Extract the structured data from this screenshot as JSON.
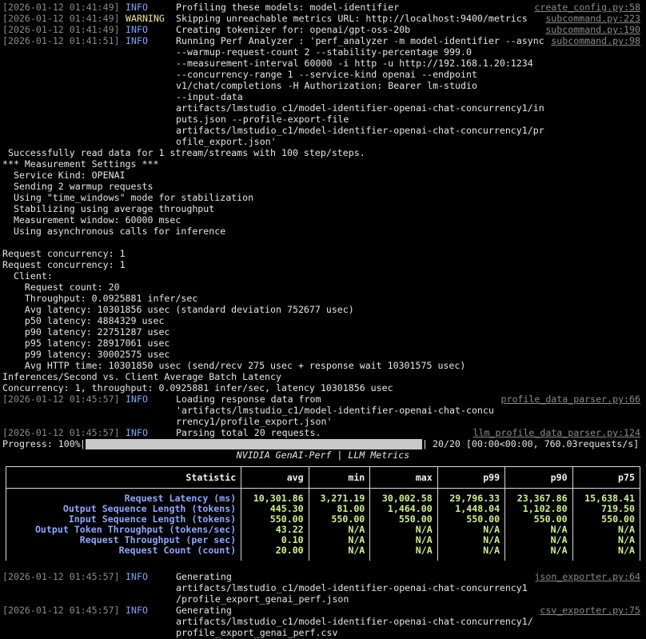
{
  "log_top": [
    {
      "ts": "[2026-01-12 01:41:49]",
      "level": "INFO",
      "msg": "Profiling these models: model-identifier",
      "src": "create_config.py:58"
    },
    {
      "ts": "[2026-01-12 01:41:49]",
      "level": "WARNING",
      "msg": "Skipping unreachable metrics URL: http://localhost:9400/metrics",
      "src": "subcommand.py:223"
    },
    {
      "ts": "[2026-01-12 01:41:49]",
      "level": "INFO",
      "msg": "Creating tokenizer for: openai/gpt-oss-20b",
      "src": "subcommand.py:190"
    },
    {
      "ts": "[2026-01-12 01:41:51]",
      "level": "INFO",
      "msg": "Running Perf Analyzer : 'perf_analyzer -m model-identifier --async",
      "src": "subcommand.py:98"
    }
  ],
  "perf_cmd_cont": [
    "--warmup-request-count 2 --stability-percentage 999.0",
    "--measurement-interval 60000 -i http -u http://192.168.1.20:1234",
    "--concurrency-range 1 --service-kind openai --endpoint",
    "v1/chat/completions -H Authorization: Bearer lm-studio",
    "--input-data",
    "artifacts/lmstudio_c1/model-identifier-openai-chat-concurrency1/in",
    "puts.json --profile-export-file",
    "artifacts/lmstudio_c1/model-identifier-openai-chat-concurrency1/pr",
    "ofile_export.json'"
  ],
  "pa_output": [
    " Successfully read data for 1 stream/streams with 100 step/steps.",
    "*** Measurement Settings ***",
    "  Service Kind: OPENAI",
    "  Sending 2 warmup requests",
    "  Using \"time_windows\" mode for stabilization",
    "  Stabilizing using average throughput",
    "  Measurement window: 60000 msec",
    "  Using asynchronous calls for inference",
    "",
    "Request concurrency: 1",
    "Request concurrency: 1",
    "  Client:",
    "    Request count: 20",
    "    Throughput: 0.0925881 infer/sec",
    "    Avg latency: 10301856 usec (standard deviation 752677 usec)",
    "    p50 latency: 4884329 usec",
    "    p90 latency: 22751287 usec",
    "    p95 latency: 28917061 usec",
    "    p99 latency: 30002575 usec",
    "    Avg HTTP time: 10301850 usec (send/recv 275 usec + response wait 10301575 usec)",
    "Inferences/Second vs. Client Average Batch Latency",
    "Concurrency: 1, throughput: 0.0925881 infer/sec, latency 10301856 usec"
  ],
  "log_parse": [
    {
      "ts": "[2026-01-12 01:45:57]",
      "level": "INFO",
      "msg": "Loading response data from",
      "src": "profile_data_parser.py:66"
    },
    {
      "ts": "[2026-01-12 01:45:57]",
      "level": "INFO",
      "msg": "Parsing total 20 requests.",
      "src": "llm_profile_data_parser.py:124"
    }
  ],
  "parse_cont": [
    "'artifacts/lmstudio_c1/model-identifier-openai-chat-concu",
    "rrency1/profile_export.json'"
  ],
  "progress": {
    "label": "Progress: 100%",
    "fraction": 1.0,
    "counts": "20/20 [00:00<00:00, 760.03requests/s]"
  },
  "table": {
    "title": "NVIDIA GenAI-Perf | LLM Metrics",
    "headers": [
      "Statistic",
      "avg",
      "min",
      "max",
      "p99",
      "p90",
      "p75"
    ],
    "rows": [
      [
        "Request Latency (ms)",
        "10,301.86",
        "3,271.19",
        "30,002.58",
        "29,796.33",
        "23,367.86",
        "15,638.41"
      ],
      [
        "Output Sequence Length (tokens)",
        "445.30",
        "81.00",
        "1,464.00",
        "1,448.04",
        "1,102.80",
        "719.50"
      ],
      [
        "Input Sequence Length (tokens)",
        "550.00",
        "550.00",
        "550.00",
        "550.00",
        "550.00",
        "550.00"
      ],
      [
        "Output Token Throughput (tokens/sec)",
        "43.22",
        "N/A",
        "N/A",
        "N/A",
        "N/A",
        "N/A"
      ],
      [
        "Request Throughput (per sec)",
        "0.10",
        "N/A",
        "N/A",
        "N/A",
        "N/A",
        "N/A"
      ],
      [
        "Request Count (count)",
        "20.00",
        "N/A",
        "N/A",
        "N/A",
        "N/A",
        "N/A"
      ]
    ]
  },
  "log_export": [
    {
      "ts": "[2026-01-12 01:45:57]",
      "level": "INFO",
      "msg": "Generating",
      "src": "json_exporter.py:64",
      "cont": [
        "artifacts/lmstudio_c1/model-identifier-openai-chat-concurrency1",
        "/profile_export_genai_perf.json"
      ]
    },
    {
      "ts": "[2026-01-12 01:45:57]",
      "level": "INFO",
      "msg": "Generating",
      "src": "csv_exporter.py:75",
      "cont": [
        "artifacts/lmstudio_c1/model-identifier-openai-chat-concurrency1/",
        "profile_export_genai_perf.csv"
      ]
    }
  ],
  "colors": {
    "info": "#7ea3ff",
    "warning": "#f3e6a0",
    "timestamp": "#8a8a8a",
    "stat": "#8fa6ff",
    "value": "#d0f28a"
  }
}
